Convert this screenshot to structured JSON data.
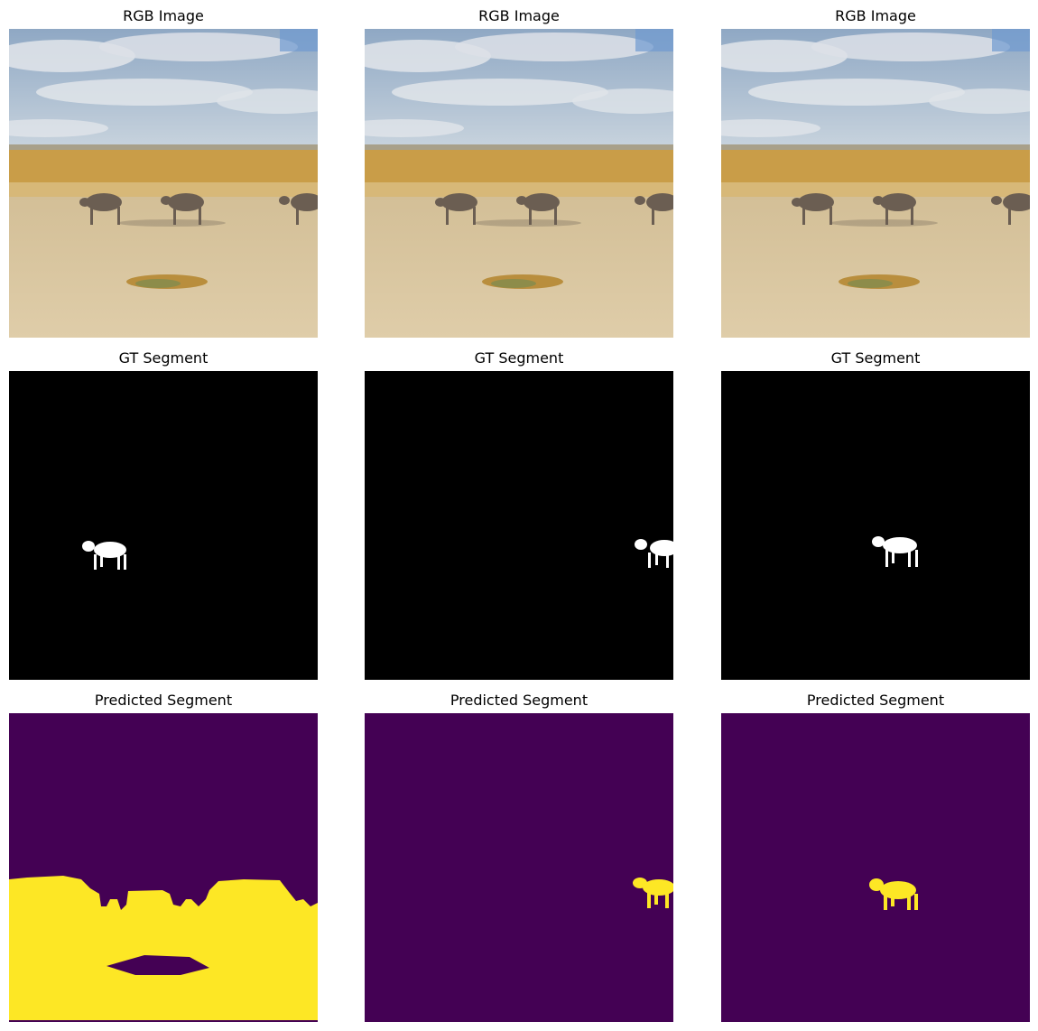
{
  "figure": {
    "rows": [
      {
        "title": "RGB Image",
        "kind": "rgb"
      },
      {
        "title": "GT Segment",
        "kind": "gt"
      },
      {
        "title": "Predicted Segment",
        "kind": "pred"
      }
    ],
    "columns": 3,
    "colors": {
      "sky": "#7d9bbd",
      "cloud": "#dfe2e6",
      "grass": "#caa04e",
      "ground": "#d9c6a0",
      "animal": "#6d5f53",
      "mask_bg": "#000000",
      "mask_fg": "#ffffff",
      "viridis_low": "#440154",
      "viridis_high": "#fde725"
    }
  }
}
